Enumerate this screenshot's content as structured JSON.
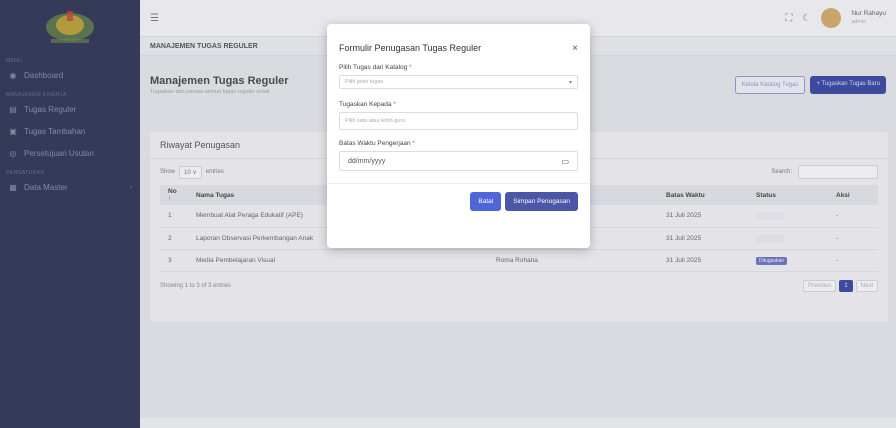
{
  "sidebar": {
    "logo_caption": "",
    "sections": [
      {
        "title": "MENU"
      },
      {
        "title": "MANAJEMEN KINERJA"
      },
      {
        "title": "PENGATURAN"
      }
    ],
    "items": [
      {
        "label": "Dashboard",
        "icon": "dashboard-icon"
      },
      {
        "label": "Tugas Reguler",
        "icon": "clipboard-icon"
      },
      {
        "label": "Tugas Tambahan",
        "icon": "list-icon"
      },
      {
        "label": "Persetujuan Usulan",
        "icon": "check-icon"
      },
      {
        "label": "Data Master",
        "icon": "database-icon"
      }
    ]
  },
  "topbar": {
    "user_name": "Nur Rahayu",
    "user_role": "admin"
  },
  "breadcrumb": "MANAJEMEN TUGAS REGULER",
  "page": {
    "title": "Manajemen Tugas Reguler",
    "subtitle": "Tugaskan dan pantau semua tugas reguler untuk",
    "btn_katalog": "Kelola Katalog Tugas",
    "btn_tugaskan": "+ Tugaskan Tugas Baru"
  },
  "card": {
    "title": "Riwayat Penugasan",
    "show_label": "Show",
    "show_value": "10",
    "entries_label": "entries",
    "search_label": "Search:",
    "columns": [
      "No",
      "Nama Tugas",
      "Batas Waktu",
      "Status",
      "Aksi"
    ],
    "rows": [
      {
        "no": "1",
        "nama": "Membuat Alat Peraga Edukatif (APE)",
        "guru": "",
        "batas": "31 Juli 2025",
        "status": "",
        "aksi": "-"
      },
      {
        "no": "2",
        "nama": "Laporan Observasi Perkembangan Anak",
        "guru": "Roma Rohana",
        "batas": "31 Juli 2025",
        "status": "",
        "aksi": "-"
      },
      {
        "no": "3",
        "nama": "Media Pembelajaran Visual",
        "guru": "Roma Rohana",
        "batas": "31 Juli 2025",
        "status": "Ditugaskan",
        "aksi": "-"
      }
    ],
    "showing": "Showing 1 to 3 of 3 entries",
    "prev": "Previous",
    "page": "1",
    "next": "Next"
  },
  "modal": {
    "title": "Formulir Penugasan Tugas Reguler",
    "close": "×",
    "f1_label": "Pilih Tugas dari Katalog",
    "f1_placeholder": "Pilih jenis tugas",
    "f2_label": "Tugaskan Kepada",
    "f2_placeholder": "Pilih satu atau lebih guru",
    "f3_label": "Batas Waktu Pengerjaan",
    "f3_placeholder": "dd/mm/yyyy",
    "btn_batal": "Batal",
    "btn_simpan": "Simpan Penugasan"
  }
}
